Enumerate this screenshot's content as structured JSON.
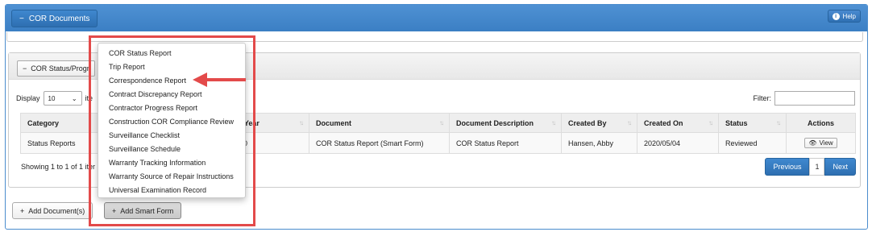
{
  "header": {
    "collapse_label": "COR Documents",
    "help_label": "Help"
  },
  "subpanel": {
    "collapse_label": "COR Status/Progr"
  },
  "table_controls": {
    "display_label": "Display",
    "display_value": "10",
    "display_suffix": "ite",
    "filter_label": "Filter:"
  },
  "table": {
    "columns": [
      "Category",
      "th Year",
      "Document",
      "Document Description",
      "Created By",
      "Created On",
      "Status",
      "Actions"
    ],
    "rows": [
      {
        "category": "Status Reports",
        "year": "020",
        "document": "COR Status Report (Smart Form)",
        "description": "COR Status Report",
        "created_by": "Hansen, Abby",
        "created_on": "2020/05/04",
        "status": "Reviewed",
        "action_label": "View"
      }
    ]
  },
  "footer": {
    "showing": "Showing 1 to 1 of 1 iter",
    "prev": "Previous",
    "page": "1",
    "next": "Next"
  },
  "buttons": {
    "add_document": "Add Document(s)",
    "add_smart_form": "Add Smart Form"
  },
  "smart_form_menu": [
    "COR Status Report",
    "Trip Report",
    "Correspondence Report",
    "Contract Discrepancy Report",
    "Contractor Progress Report",
    "Construction COR Compliance Review",
    "Surveillance Checklist",
    "Surveillance Schedule",
    "Warranty Tracking Information",
    "Warranty Source of Repair Instructions",
    "Universal Examination Record"
  ],
  "colors": {
    "header_blue": "#3b7fc4",
    "annotation_red": "#e34a4a"
  }
}
